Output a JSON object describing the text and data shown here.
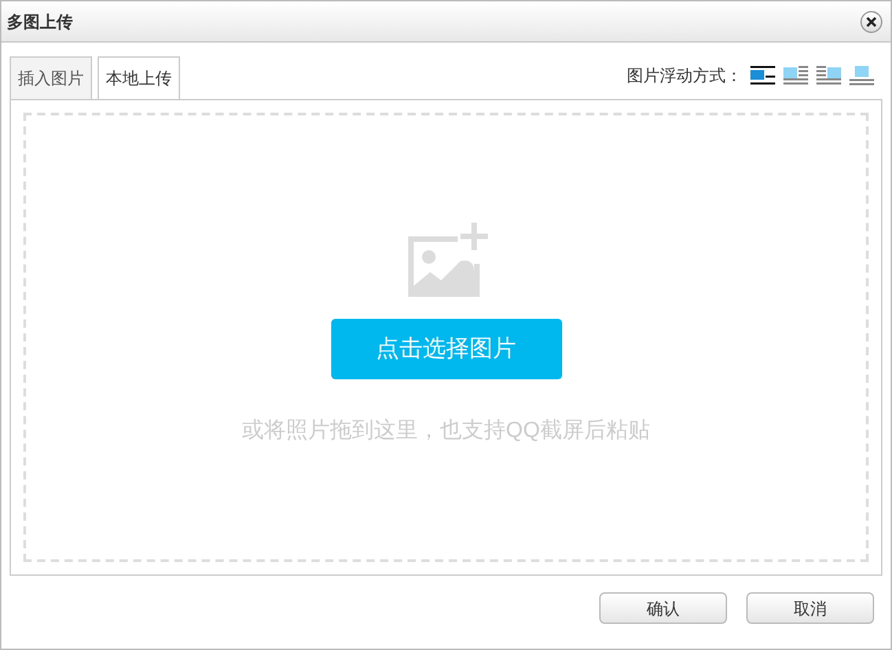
{
  "window": {
    "title": "多图上传"
  },
  "tabs": [
    {
      "label": "插入图片",
      "selected": false
    },
    {
      "label": "本地上传",
      "selected": true
    }
  ],
  "float_mode": {
    "label": "图片浮动方式：",
    "options": [
      {
        "kind": "none",
        "selected": true
      },
      {
        "kind": "left",
        "selected": false
      },
      {
        "kind": "right",
        "selected": false
      },
      {
        "kind": "center",
        "selected": false
      }
    ]
  },
  "upload": {
    "button": "点击选择图片",
    "hint": "或将照片拖到这里，也支持QQ截屏后粘贴"
  },
  "buttons": [
    "确认",
    "取消"
  ]
}
